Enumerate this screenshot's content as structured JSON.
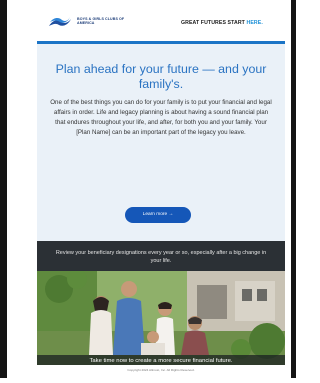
{
  "header": {
    "logo_label": "BOYS & GIRLS CLUBS OF AMERICA",
    "logo_icon": "bgca-hands-logo-icon",
    "tagline_main": "GREAT FUTURES START ",
    "tagline_accent": "HERE."
  },
  "hero": {
    "headline": "Plan ahead for your future — and your family's.",
    "body": "One of the best things you can do for your family is to put your financial and legal affairs in order. Life and legacy planning is about having a sound financial plan that endures throughout your life, and after, for both you and your family. Your [Plan Name] can be an important part of the legacy you leave.",
    "cta_label": "Learn more →"
  },
  "band": {
    "text": "Review your beneficiary designations every year or so, especially after a big change in your life."
  },
  "photo": {
    "caption": "Take time now to create a more secure financial future."
  },
  "footer": {
    "copyright": "Copyright 2024 Allmost, Inc. All Rights Reserved."
  },
  "colors": {
    "accent_blue": "#2a73c2",
    "button_blue": "#1557b8",
    "rule_blue": "#1b74c6",
    "hero_bg": "#eaf1f8",
    "band_bg": "#2b3035"
  }
}
